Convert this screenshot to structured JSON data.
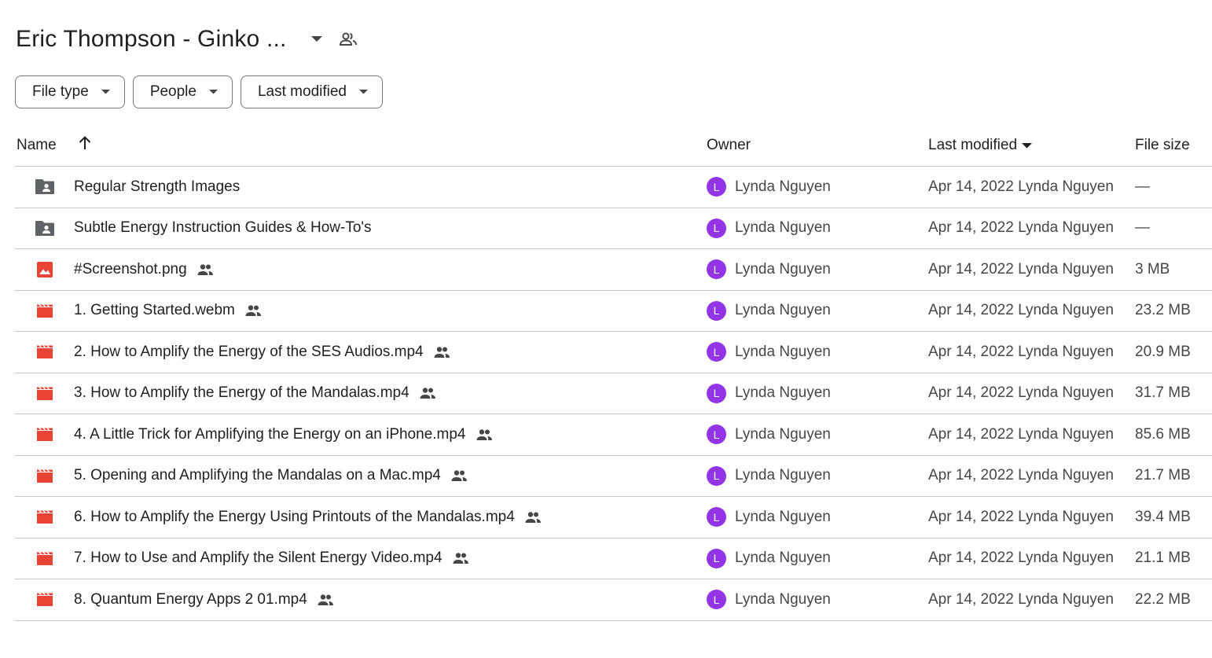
{
  "header": {
    "title": "Eric Thompson - Ginko ...",
    "caret_icon": "arrow-drop-down-icon",
    "share_icon": "people-icon"
  },
  "filters": [
    {
      "label": "File type"
    },
    {
      "label": "People"
    },
    {
      "label": "Last modified"
    }
  ],
  "table": {
    "columns": {
      "name": "Name",
      "owner": "Owner",
      "last_modified": "Last modified",
      "file_size": "File size"
    },
    "sort": {
      "column": "Last modified",
      "name_sort_icon": "arrow-upward-icon"
    },
    "rows": [
      {
        "icon": "shared-folder-icon",
        "name": "Regular Strength Images",
        "shared": false,
        "owner_initial": "L",
        "owner": "Lynda Nguyen",
        "modified": "Apr 14, 2022 Lynda Nguyen",
        "size": "—"
      },
      {
        "icon": "shared-folder-icon",
        "name": "Subtle Energy Instruction Guides & How-To's",
        "shared": false,
        "owner_initial": "L",
        "owner": "Lynda Nguyen",
        "modified": "Apr 14, 2022 Lynda Nguyen",
        "size": "—"
      },
      {
        "icon": "image-file-icon",
        "name": "#Screenshot.png",
        "shared": true,
        "owner_initial": "L",
        "owner": "Lynda Nguyen",
        "modified": "Apr 14, 2022 Lynda Nguyen",
        "size": "3 MB"
      },
      {
        "icon": "video-file-icon",
        "name": "1. Getting Started.webm",
        "shared": true,
        "owner_initial": "L",
        "owner": "Lynda Nguyen",
        "modified": "Apr 14, 2022 Lynda Nguyen",
        "size": "23.2 MB"
      },
      {
        "icon": "video-file-icon",
        "name": "2. How to Amplify the Energy of the SES Audios.mp4",
        "shared": true,
        "owner_initial": "L",
        "owner": "Lynda Nguyen",
        "modified": "Apr 14, 2022 Lynda Nguyen",
        "size": "20.9 MB"
      },
      {
        "icon": "video-file-icon",
        "name": "3. How to Amplify the Energy of the Mandalas.mp4",
        "shared": true,
        "owner_initial": "L",
        "owner": "Lynda Nguyen",
        "modified": "Apr 14, 2022 Lynda Nguyen",
        "size": "31.7 MB"
      },
      {
        "icon": "video-file-icon",
        "name": "4. A Little Trick for Amplifying the Energy on an iPhone.mp4",
        "shared": true,
        "owner_initial": "L",
        "owner": "Lynda Nguyen",
        "modified": "Apr 14, 2022 Lynda Nguyen",
        "size": "85.6 MB"
      },
      {
        "icon": "video-file-icon",
        "name": "5. Opening and Amplifying the Mandalas on a Mac.mp4",
        "shared": true,
        "owner_initial": "L",
        "owner": "Lynda Nguyen",
        "modified": "Apr 14, 2022 Lynda Nguyen",
        "size": "21.7 MB"
      },
      {
        "icon": "video-file-icon",
        "name": "6. How to Amplify the Energy Using Printouts of the Mandalas.mp4",
        "shared": true,
        "owner_initial": "L",
        "owner": "Lynda Nguyen",
        "modified": "Apr 14, 2022 Lynda Nguyen",
        "size": "39.4 MB"
      },
      {
        "icon": "video-file-icon",
        "name": "7. How to Use and Amplify the Silent Energy Video.mp4",
        "shared": true,
        "owner_initial": "L",
        "owner": "Lynda Nguyen",
        "modified": "Apr 14, 2022 Lynda Nguyen",
        "size": "21.1 MB"
      },
      {
        "icon": "video-file-icon",
        "name": "8. Quantum Energy Apps 2 01.mp4",
        "shared": true,
        "owner_initial": "L",
        "owner": "Lynda Nguyen",
        "modified": "Apr 14, 2022 Lynda Nguyen",
        "size": "22.2 MB"
      }
    ]
  },
  "colors": {
    "text": "#1f1f1f",
    "secondary_text": "#444746",
    "avatar": "#9334e6",
    "folder_icon": "#5f6368",
    "red_file_icon": "#ea4335",
    "divider": "#c7c7c7"
  }
}
